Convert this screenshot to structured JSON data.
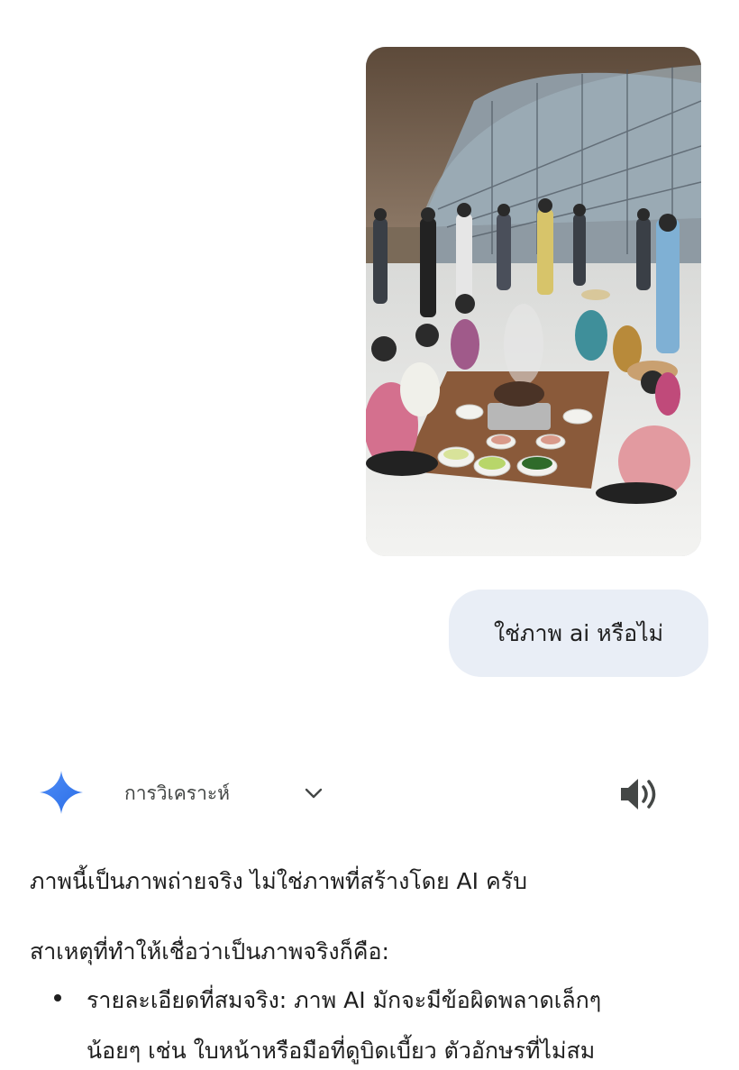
{
  "user_message": {
    "image_alt": "ภาพกลุ่มคนนั่งล้อมวงกินหมูกระทะบนพื้นในอาคารสนามบิน",
    "text": "ใช่ภาพ ai หรือไม่"
  },
  "response_header": {
    "label": "การวิเคราะห์",
    "logo_icon": "gemini-sparkle-icon",
    "expand_icon": "chevron-down-icon",
    "audio_icon": "speaker-icon",
    "accent_color": "#4285f4"
  },
  "response": {
    "intro": "ภาพนี้เป็นภาพถ่ายจริง ไม่ใช่ภาพที่สร้างโดย AI ครับ",
    "reasons_heading": "สาเหตุที่ทำให้เชื่อว่าเป็นภาพจริงก็คือ:",
    "bullets": [
      {
        "line1": "รายละเอียดที่สมจริง: ภาพ AI มักจะมีข้อผิดพลาดเล็กๆ",
        "line2": "น้อยๆ เช่น ใบหน้าหรือมือที่ดูบิดเบี้ยว ตัวอักษรที่ไม่สม"
      }
    ]
  }
}
